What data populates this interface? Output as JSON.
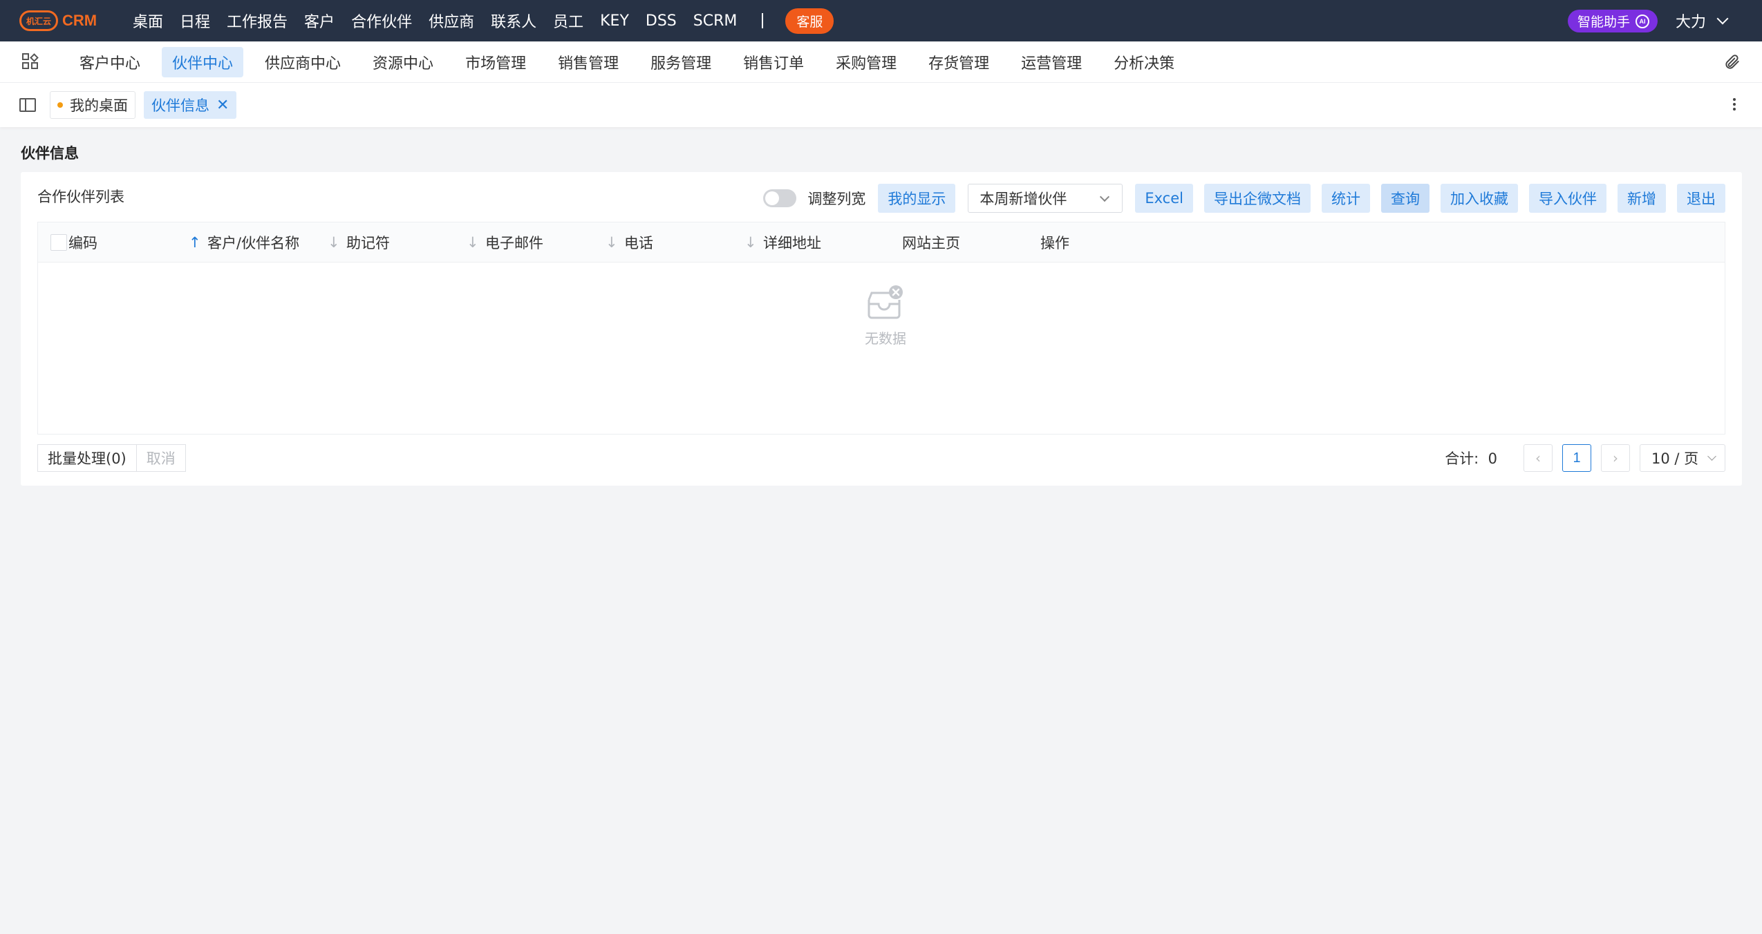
{
  "brand": {
    "logo_mark": "机汇云",
    "name": "CRM",
    "color": "#f26a21"
  },
  "topnav": {
    "items": [
      "桌面",
      "日程",
      "工作报告",
      "客户",
      "合作伙伴",
      "供应商",
      "联系人",
      "员工",
      "KEY",
      "DSS",
      "SCRM"
    ],
    "service_label": "客服",
    "ai_label": "智能助手",
    "ai_badge": "AI",
    "user_name": "大力"
  },
  "secnav": {
    "tabs": [
      "客户中心",
      "伙伴中心",
      "供应商中心",
      "资源中心",
      "市场管理",
      "销售管理",
      "服务管理",
      "销售订单",
      "采购管理",
      "存货管理",
      "运营管理",
      "分析决策"
    ],
    "active_index": 1
  },
  "pagetabs": {
    "home_label": "我的桌面",
    "active_label": "伙伴信息",
    "close_symbol": "✕"
  },
  "page": {
    "title": "伙伴信息",
    "panel_title": "合作伙伴列表"
  },
  "toolbar": {
    "adjust_width_label": "调整列宽",
    "adjust_width_on": false,
    "my_display_label": "我的显示",
    "filter_value": "本周新增伙伴",
    "buttons": [
      "Excel",
      "导出企微文档",
      "统计",
      "查询",
      "加入收藏",
      "导入伙伴",
      "新增",
      "退出"
    ]
  },
  "table": {
    "columns": [
      "编码",
      "客户/伙伴名称",
      "助记符",
      "电子邮件",
      "电话",
      "详细地址",
      "网站主页",
      "操作"
    ],
    "sort_up_symbol": "↑",
    "sort_down_symbol": "↓",
    "rows": [],
    "empty_text": "无数据"
  },
  "footer": {
    "batch_label": "批量处理(0)",
    "cancel_label": "取消",
    "total_label": "合计:",
    "total_value": "0",
    "prev_symbol": "‹",
    "next_symbol": "›",
    "current_page": "1",
    "page_size_label": "10 / 页"
  },
  "colors": {
    "topbar_bg": "#273245",
    "accent": "#1f7ad8",
    "accent_light": "#ddebfb",
    "service_badge": "#f05a1a",
    "ai_button": "#7b2fe0"
  }
}
